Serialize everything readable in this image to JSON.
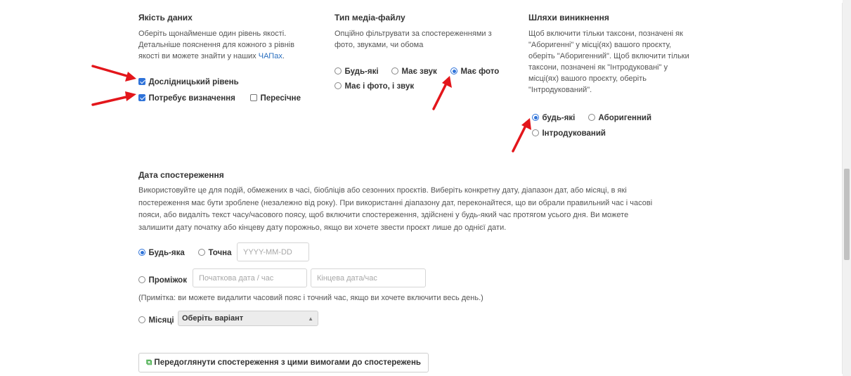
{
  "quality": {
    "title": "Якість даних",
    "desc_line1": "Оберіть щонайменше один рівень якості.",
    "desc_line2": "Детальніше пояснення для кожного з рівнів",
    "desc_line3_prefix": "якості ви можете знайти у наших ",
    "faq_link": "ЧАПах",
    "desc_line3_suffix": ".",
    "options": [
      {
        "label": "Дослідницький рівень",
        "checked": true
      },
      {
        "label": "Потребує визначення",
        "checked": true
      },
      {
        "label": "Пересічне",
        "checked": false
      }
    ]
  },
  "media": {
    "title": "Тип медіа-файлу",
    "desc_line1": "Опційно фільтрувати за спостереженнями з",
    "desc_line2": "фото, звуками, чи обома",
    "options": [
      {
        "label": "Будь-які",
        "selected": false
      },
      {
        "label": "Має звук",
        "selected": false
      },
      {
        "label": "Має фото",
        "selected": true
      },
      {
        "label": "Має і фото, і звук",
        "selected": false
      }
    ]
  },
  "origin": {
    "title": "Шляхи виникнення",
    "desc_lines": [
      "Щоб включити тільки таксони, позначені як",
      "\"Аборигенні\" у місці(ях) вашого проєкту,",
      "оберіть \"Аборигенний\". Щоб включити тільки",
      "таксони, позначені як \"Інтродуковані\" у",
      "місці(ях) вашого проєкту, оберіть",
      "\"Інтродукований\"."
    ],
    "options": [
      {
        "label": "будь-які",
        "selected": true
      },
      {
        "label": "Аборигенний",
        "selected": false
      },
      {
        "label": "Інтродукований",
        "selected": false
      }
    ]
  },
  "date": {
    "title": "Дата спостереження",
    "desc_lines": [
      "Використовуйте це для подій, обмежених в часі, біобліців або сезонних проєктів. Виберіть конкретну дату, діапазон дат, або місяці, в які",
      "постереження має бути зроблене (незалежно від року). При використанні діапазону дат, переконайтеся, що ви обрали правильний час і часові",
      "пояси, або видаліть текст часу/часового поясу, щоб включити спостереження, здійснені у будь-який час протягом усього дня. Ви можете",
      "залишити дату початку або кінцеву дату порожньо, якщо ви хочете звести проєкт лише до однієї дати."
    ],
    "any_label": "Будь-яка",
    "exact_label": "Точна",
    "exact_placeholder": "YYYY-MM-DD",
    "range_label": "Проміжок",
    "range_start_placeholder": "Початкова дата / час",
    "range_end_placeholder": "Кінцева дата/час",
    "note": "(Примітка: ви можете видалити часовий пояс і точний час, якщо ви хочете включити весь день.)",
    "months_label": "Місяці",
    "months_selected": "Оберіть варіант"
  },
  "preview_button": "Передоглянути спостереження з цими вимогами до спостережень",
  "colors": {
    "accent": "#2f73d9",
    "link": "#2a6fbf",
    "arrow": "#e3161b",
    "preview_icon": "#4caf50"
  }
}
